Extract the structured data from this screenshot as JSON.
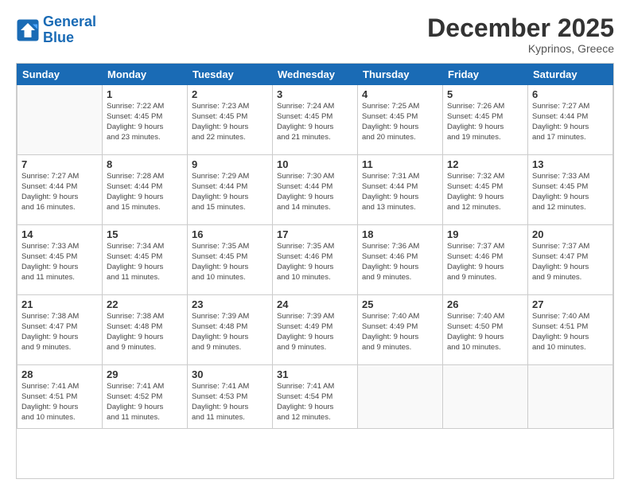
{
  "header": {
    "logo_line1": "General",
    "logo_line2": "Blue",
    "month_title": "December 2025",
    "location": "Kyprinos, Greece"
  },
  "weekdays": [
    "Sunday",
    "Monday",
    "Tuesday",
    "Wednesday",
    "Thursday",
    "Friday",
    "Saturday"
  ],
  "weeks": [
    [
      {
        "day": "",
        "info": ""
      },
      {
        "day": "1",
        "info": "Sunrise: 7:22 AM\nSunset: 4:45 PM\nDaylight: 9 hours\nand 23 minutes."
      },
      {
        "day": "2",
        "info": "Sunrise: 7:23 AM\nSunset: 4:45 PM\nDaylight: 9 hours\nand 22 minutes."
      },
      {
        "day": "3",
        "info": "Sunrise: 7:24 AM\nSunset: 4:45 PM\nDaylight: 9 hours\nand 21 minutes."
      },
      {
        "day": "4",
        "info": "Sunrise: 7:25 AM\nSunset: 4:45 PM\nDaylight: 9 hours\nand 20 minutes."
      },
      {
        "day": "5",
        "info": "Sunrise: 7:26 AM\nSunset: 4:45 PM\nDaylight: 9 hours\nand 19 minutes."
      },
      {
        "day": "6",
        "info": "Sunrise: 7:27 AM\nSunset: 4:44 PM\nDaylight: 9 hours\nand 17 minutes."
      }
    ],
    [
      {
        "day": "7",
        "info": "Sunrise: 7:27 AM\nSunset: 4:44 PM\nDaylight: 9 hours\nand 16 minutes."
      },
      {
        "day": "8",
        "info": "Sunrise: 7:28 AM\nSunset: 4:44 PM\nDaylight: 9 hours\nand 15 minutes."
      },
      {
        "day": "9",
        "info": "Sunrise: 7:29 AM\nSunset: 4:44 PM\nDaylight: 9 hours\nand 15 minutes."
      },
      {
        "day": "10",
        "info": "Sunrise: 7:30 AM\nSunset: 4:44 PM\nDaylight: 9 hours\nand 14 minutes."
      },
      {
        "day": "11",
        "info": "Sunrise: 7:31 AM\nSunset: 4:44 PM\nDaylight: 9 hours\nand 13 minutes."
      },
      {
        "day": "12",
        "info": "Sunrise: 7:32 AM\nSunset: 4:45 PM\nDaylight: 9 hours\nand 12 minutes."
      },
      {
        "day": "13",
        "info": "Sunrise: 7:33 AM\nSunset: 4:45 PM\nDaylight: 9 hours\nand 12 minutes."
      }
    ],
    [
      {
        "day": "14",
        "info": "Sunrise: 7:33 AM\nSunset: 4:45 PM\nDaylight: 9 hours\nand 11 minutes."
      },
      {
        "day": "15",
        "info": "Sunrise: 7:34 AM\nSunset: 4:45 PM\nDaylight: 9 hours\nand 11 minutes."
      },
      {
        "day": "16",
        "info": "Sunrise: 7:35 AM\nSunset: 4:45 PM\nDaylight: 9 hours\nand 10 minutes."
      },
      {
        "day": "17",
        "info": "Sunrise: 7:35 AM\nSunset: 4:46 PM\nDaylight: 9 hours\nand 10 minutes."
      },
      {
        "day": "18",
        "info": "Sunrise: 7:36 AM\nSunset: 4:46 PM\nDaylight: 9 hours\nand 9 minutes."
      },
      {
        "day": "19",
        "info": "Sunrise: 7:37 AM\nSunset: 4:46 PM\nDaylight: 9 hours\nand 9 minutes."
      },
      {
        "day": "20",
        "info": "Sunrise: 7:37 AM\nSunset: 4:47 PM\nDaylight: 9 hours\nand 9 minutes."
      }
    ],
    [
      {
        "day": "21",
        "info": "Sunrise: 7:38 AM\nSunset: 4:47 PM\nDaylight: 9 hours\nand 9 minutes."
      },
      {
        "day": "22",
        "info": "Sunrise: 7:38 AM\nSunset: 4:48 PM\nDaylight: 9 hours\nand 9 minutes."
      },
      {
        "day": "23",
        "info": "Sunrise: 7:39 AM\nSunset: 4:48 PM\nDaylight: 9 hours\nand 9 minutes."
      },
      {
        "day": "24",
        "info": "Sunrise: 7:39 AM\nSunset: 4:49 PM\nDaylight: 9 hours\nand 9 minutes."
      },
      {
        "day": "25",
        "info": "Sunrise: 7:40 AM\nSunset: 4:49 PM\nDaylight: 9 hours\nand 9 minutes."
      },
      {
        "day": "26",
        "info": "Sunrise: 7:40 AM\nSunset: 4:50 PM\nDaylight: 9 hours\nand 10 minutes."
      },
      {
        "day": "27",
        "info": "Sunrise: 7:40 AM\nSunset: 4:51 PM\nDaylight: 9 hours\nand 10 minutes."
      }
    ],
    [
      {
        "day": "28",
        "info": "Sunrise: 7:41 AM\nSunset: 4:51 PM\nDaylight: 9 hours\nand 10 minutes."
      },
      {
        "day": "29",
        "info": "Sunrise: 7:41 AM\nSunset: 4:52 PM\nDaylight: 9 hours\nand 11 minutes."
      },
      {
        "day": "30",
        "info": "Sunrise: 7:41 AM\nSunset: 4:53 PM\nDaylight: 9 hours\nand 11 minutes."
      },
      {
        "day": "31",
        "info": "Sunrise: 7:41 AM\nSunset: 4:54 PM\nDaylight: 9 hours\nand 12 minutes."
      },
      {
        "day": "",
        "info": ""
      },
      {
        "day": "",
        "info": ""
      },
      {
        "day": "",
        "info": ""
      }
    ]
  ]
}
